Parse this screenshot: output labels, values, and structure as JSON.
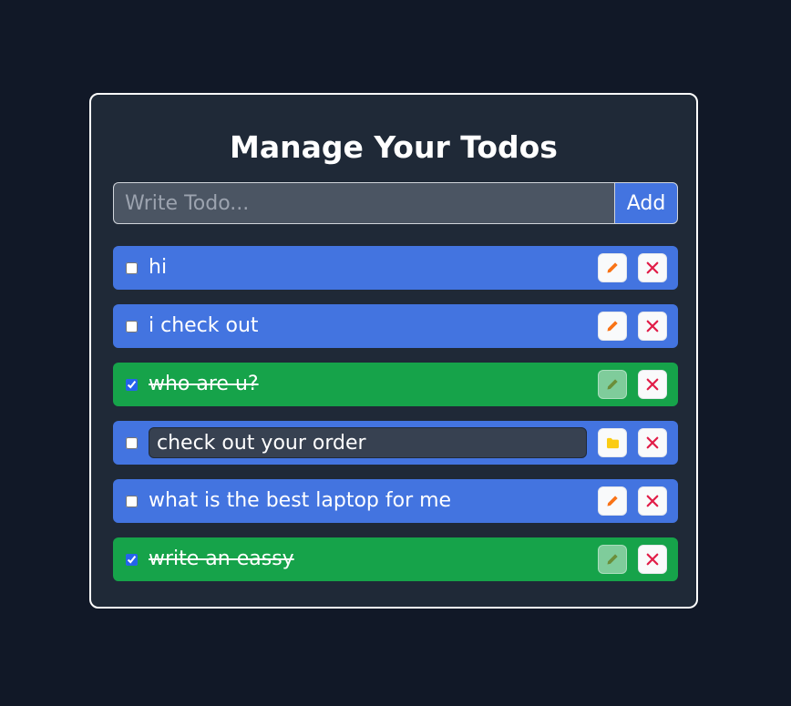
{
  "app": {
    "title": "Manage Your Todos"
  },
  "add_form": {
    "placeholder": "Write Todo...",
    "button_label": "Add"
  },
  "colors": {
    "background": "#111827",
    "card": "#1f2937",
    "pending": "#4374e0",
    "completed": "#16a34a",
    "edit_icon": "#f97316",
    "delete_icon": "#e11d48",
    "save_icon": "#facc15"
  },
  "todos": [
    {
      "text": "hi",
      "completed": false,
      "editing": false,
      "action_icon": "pencil-icon",
      "delete_icon": "close-icon"
    },
    {
      "text": "i check out",
      "completed": false,
      "editing": false,
      "action_icon": "pencil-icon",
      "delete_icon": "close-icon"
    },
    {
      "text": "who are u?",
      "completed": true,
      "editing": false,
      "action_icon": "pencil-icon",
      "delete_icon": "close-icon"
    },
    {
      "text": "check out your order",
      "completed": false,
      "editing": true,
      "action_icon": "folder-icon",
      "delete_icon": "close-icon"
    },
    {
      "text": "what is the best laptop for me",
      "completed": false,
      "editing": false,
      "action_icon": "pencil-icon",
      "delete_icon": "close-icon"
    },
    {
      "text": "write an eassy",
      "completed": true,
      "editing": false,
      "action_icon": "pencil-icon",
      "delete_icon": "close-icon"
    }
  ]
}
